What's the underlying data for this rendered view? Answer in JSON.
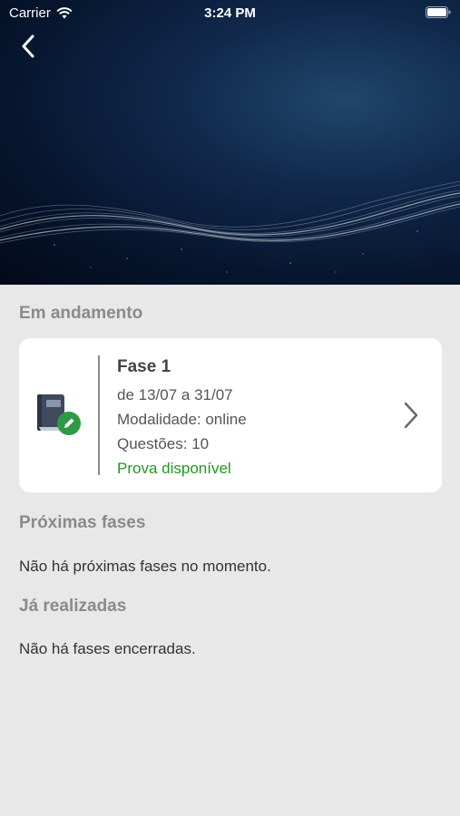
{
  "status_bar": {
    "carrier": "Carrier",
    "time": "3:24 PM"
  },
  "sections": {
    "in_progress": {
      "title": "Em andamento",
      "card": {
        "title": "Fase 1",
        "dates": "de 13/07 a 31/07",
        "modality": "Modalidade: online",
        "questions": "Questões: 10",
        "status": "Prova disponível"
      }
    },
    "upcoming": {
      "title": "Próximas fases",
      "empty_message": "Não há próximas fases no momento."
    },
    "completed": {
      "title": "Já realizadas",
      "empty_message": "Não há fases encerradas."
    }
  },
  "colors": {
    "background": "#e8e8e8",
    "card": "#ffffff",
    "status_available": "#1e9a1e",
    "section_title": "#8a8a8a",
    "icon_book": "#3f4a5e",
    "icon_badge": "#2e9a45"
  },
  "icons": {
    "back": "chevron-left-icon",
    "wifi": "wifi-icon",
    "battery": "battery-icon",
    "book": "book-edit-icon",
    "chevron": "chevron-right-icon"
  }
}
